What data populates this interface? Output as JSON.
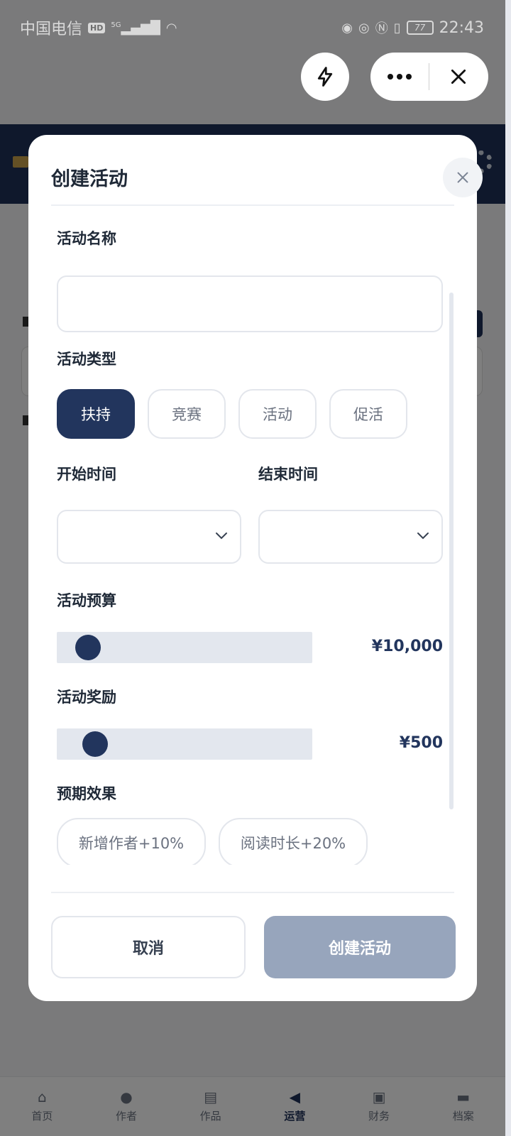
{
  "status_bar": {
    "carrier": "中国电信",
    "hd": "HD",
    "network": "5G",
    "battery": "77",
    "time": "22:43"
  },
  "capsule": {
    "flash_icon": "lightning-icon",
    "more_icon": "more-dots-icon",
    "close_icon": "close-icon"
  },
  "modal": {
    "title": "创建活动",
    "close_icon": "close-icon",
    "fields": {
      "name_label": "活动名称",
      "name_value": "",
      "type_label": "活动类型",
      "type_options": [
        "扶持",
        "竞赛",
        "活动",
        "促活"
      ],
      "type_selected": "扶持",
      "start_label": "开始时间",
      "start_value": "",
      "end_label": "结束时间",
      "end_value": "",
      "budget_label": "活动预算",
      "budget_value": "¥10,000",
      "reward_label": "活动奖励",
      "reward_value": "¥500",
      "effect_label": "预期效果",
      "effect_options": [
        "新增作者+10%",
        "阅读时长+20%"
      ]
    },
    "footer": {
      "cancel_label": "取消",
      "create_label": "创建活动"
    }
  },
  "bottom_nav": {
    "items": [
      {
        "label": "首页",
        "icon": "home-icon"
      },
      {
        "label": "作者",
        "icon": "person-icon"
      },
      {
        "label": "作品",
        "icon": "book-icon"
      },
      {
        "label": "运营",
        "icon": "megaphone-icon"
      },
      {
        "label": "财务",
        "icon": "wallet-icon"
      },
      {
        "label": "档案",
        "icon": "folder-icon"
      }
    ],
    "active": "运营"
  },
  "colors": {
    "primary": "#22355d",
    "header": "#1e3158",
    "disabled_button": "#97a5bc",
    "slider_track": "#e3e7ee"
  }
}
